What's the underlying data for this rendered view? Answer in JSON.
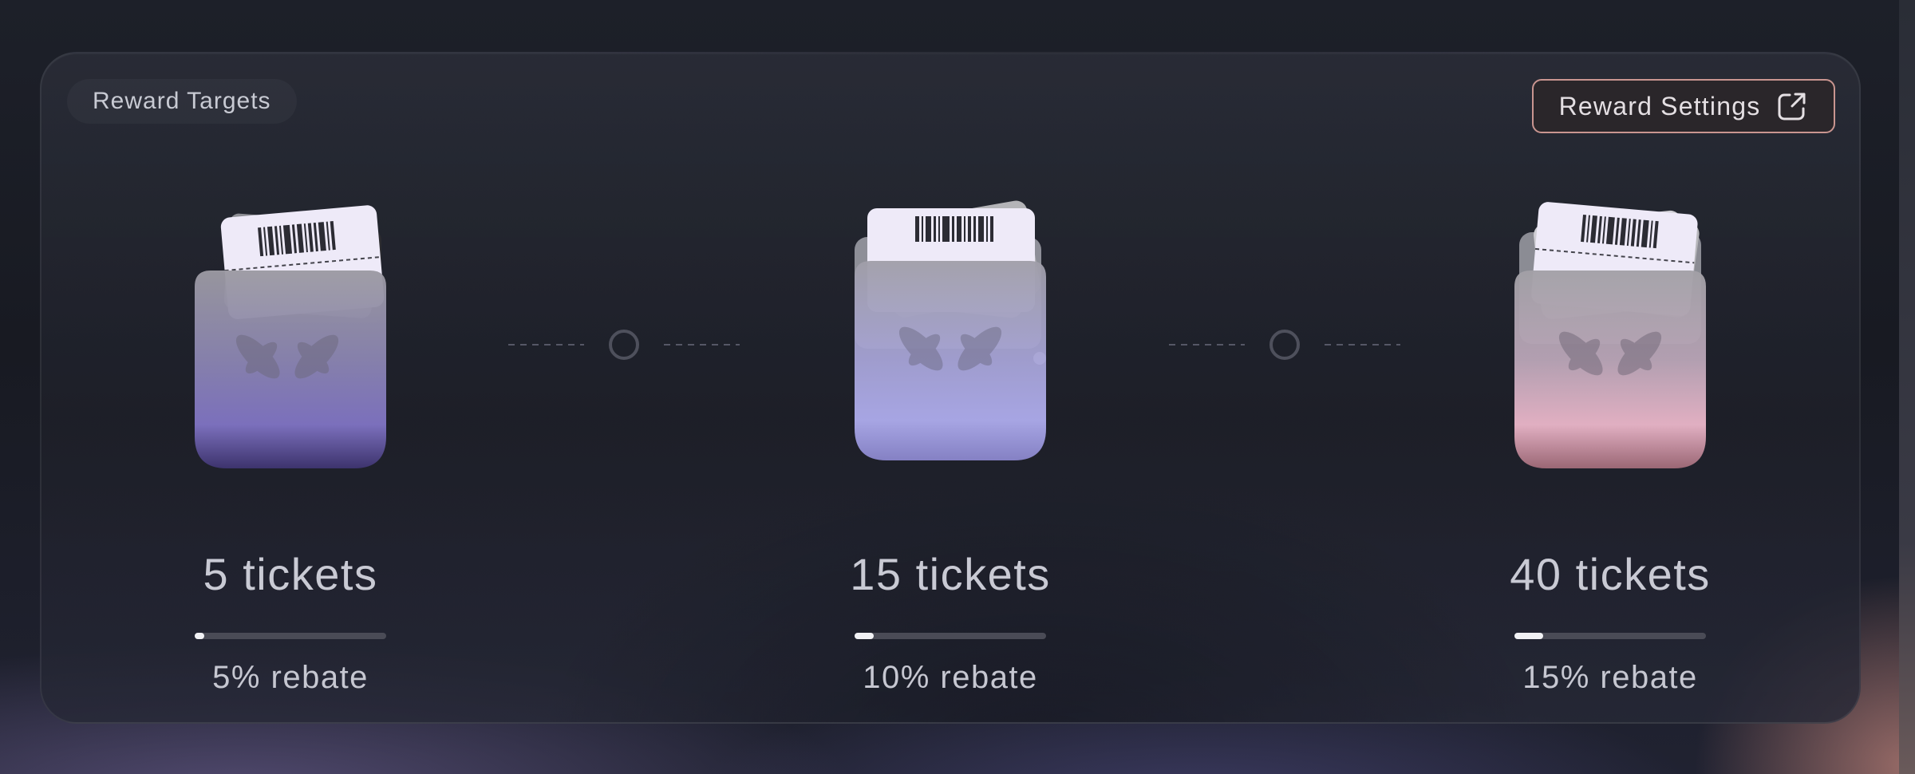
{
  "panel": {
    "title": "Reward Targets",
    "settings_label": "Reward Settings",
    "settings_icon": "external-link-icon"
  },
  "tiers": [
    {
      "tickets": "5 tickets",
      "rebate": "5% rebate",
      "progress": 0.05,
      "color": "#7b6fc0"
    },
    {
      "tickets": "15 tickets",
      "rebate": "10% rebate",
      "progress": 0.1,
      "color": "#aba9ea"
    },
    {
      "tickets": "40 tickets",
      "rebate": "15% rebate",
      "progress": 0.15,
      "color": "#e6b6c8"
    }
  ],
  "colors": {
    "accent_border": "#c99590",
    "text": "#c9cad4",
    "progress_track": "#4a4b56",
    "progress_fill": "#f1f1f4"
  }
}
